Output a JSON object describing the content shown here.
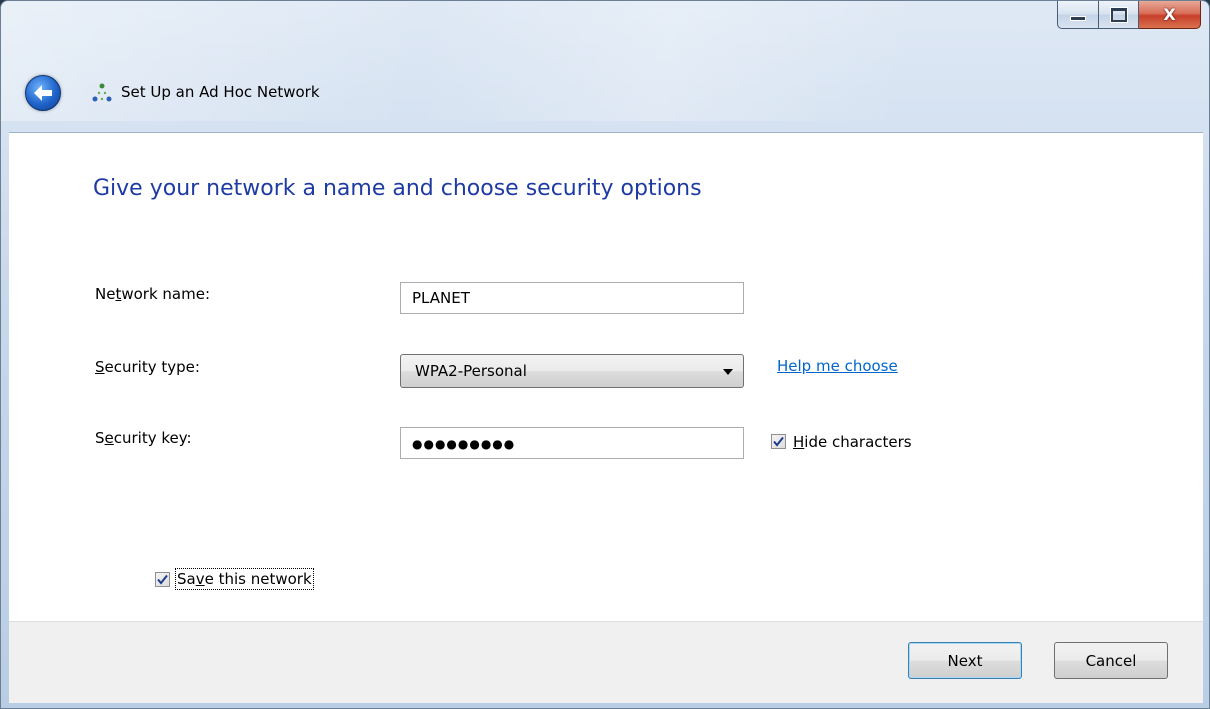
{
  "window": {
    "controls": {
      "minimize_icon": "minimize-icon",
      "maximize_icon": "maximize-icon",
      "close_glyph": "X"
    }
  },
  "header": {
    "back_icon": "back-arrow-icon",
    "wizard_icon": "ad-hoc-network-icon",
    "title": "Set Up an Ad Hoc Network"
  },
  "main": {
    "heading": "Give your network a name and choose security options",
    "network_name": {
      "label_pre": "Ne",
      "label_key": "t",
      "label_post": "work name:",
      "value": "PLANET"
    },
    "security_type": {
      "label_key": "S",
      "label_post": "ecurity type:",
      "selected": "WPA2-Personal",
      "help_link": "Help me choose"
    },
    "security_key": {
      "label_pre": "S",
      "label_key": "e",
      "label_post": "curity key:",
      "value": "●●●●●●●●●"
    },
    "hide_characters": {
      "checked": true,
      "label_key": "H",
      "label_post": "ide characters"
    },
    "save_network": {
      "checked": true,
      "label_pre": "Sa",
      "label_key": "v",
      "label_post": "e this network"
    }
  },
  "footer": {
    "next_label": "Next",
    "cancel_label": "Cancel"
  },
  "colors": {
    "heading": "#1e3ba3",
    "link": "#0066cc",
    "footer_bg": "#f0f0f0"
  }
}
